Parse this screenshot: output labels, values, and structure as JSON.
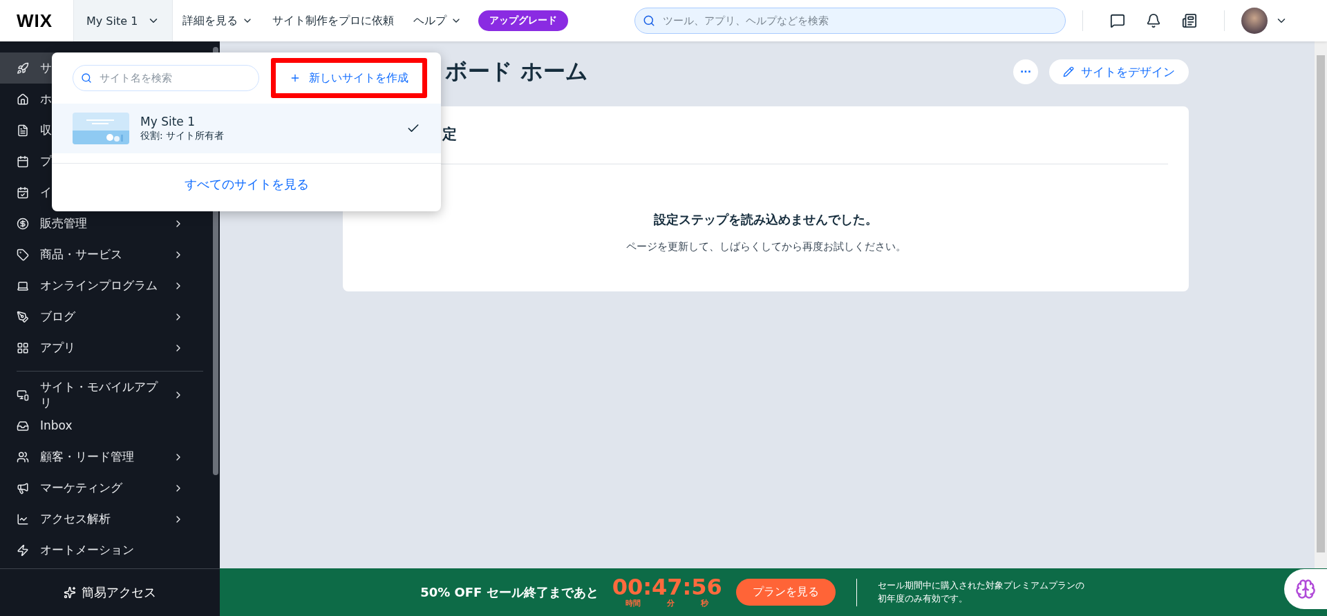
{
  "topbar": {
    "logo": "WIX",
    "site_tab": {
      "label": "My Site 1",
      "selected": true
    },
    "nav": [
      {
        "label": "詳細を見る",
        "dropdown": true
      },
      {
        "label": "サイト制作をプロに依頼",
        "dropdown": false
      },
      {
        "label": "ヘルプ",
        "dropdown": true
      }
    ],
    "upgrade": "アップグレード",
    "search": {
      "placeholder": "ツール、アプリ、ヘルプなどを検索"
    }
  },
  "sidebar": {
    "items": [
      {
        "label": "サ",
        "selected": true,
        "chevron": false
      },
      {
        "label": "ホ",
        "selected": false,
        "chevron": false
      },
      {
        "label": "収",
        "selected": false,
        "chevron": false
      },
      {
        "label": "プ",
        "selected": false,
        "chevron": false
      },
      {
        "label": "イ",
        "selected": false,
        "chevron": false
      },
      {
        "label": "販売管理",
        "selected": false,
        "chevron": true
      },
      {
        "label": "商品・サービス",
        "selected": false,
        "chevron": true
      },
      {
        "label": "オンラインプログラム",
        "selected": false,
        "chevron": true
      },
      {
        "label": "ブログ",
        "selected": false,
        "chevron": true
      },
      {
        "label": "アプリ",
        "selected": false,
        "chevron": true
      },
      {
        "label": "サイト・モバイルアプリ",
        "selected": false,
        "chevron": true
      },
      {
        "label": "Inbox",
        "selected": false,
        "chevron": false
      },
      {
        "label": "顧客・リード管理",
        "selected": false,
        "chevron": true
      },
      {
        "label": "マーケティング",
        "selected": false,
        "chevron": true
      },
      {
        "label": "アクセス解析",
        "selected": false,
        "chevron": true
      },
      {
        "label": "オートメーション",
        "selected": false,
        "chevron": false
      }
    ],
    "quick_access": "簡易アクセス"
  },
  "site_menu": {
    "search": {
      "placeholder": "サイト名を検索"
    },
    "create_button": {
      "label": "新しいサイトを作成",
      "highlighted": true
    },
    "sites": [
      {
        "name": "My Site 1",
        "role": "役割: サイト所有者",
        "selected": true
      }
    ],
    "view_all": "すべてのサイトを見る"
  },
  "main": {
    "heading": "ボード ホーム",
    "more_button": "···",
    "design_button": "サイトをデザイン",
    "card": {
      "title": "定",
      "error_title": "設定ステップを読み込めませんでした。",
      "error_text": "ページを更新して、しばらくしてから再度お試しください。"
    }
  },
  "banner": {
    "headline": "50% OFF セール終了まであと",
    "countdown": "00:47:56",
    "units": [
      "時間",
      "分",
      "秒"
    ],
    "button": "プランを見る",
    "note": "セール期間中に購入された対象プレミアムプランの初年度のみ有効です。"
  }
}
